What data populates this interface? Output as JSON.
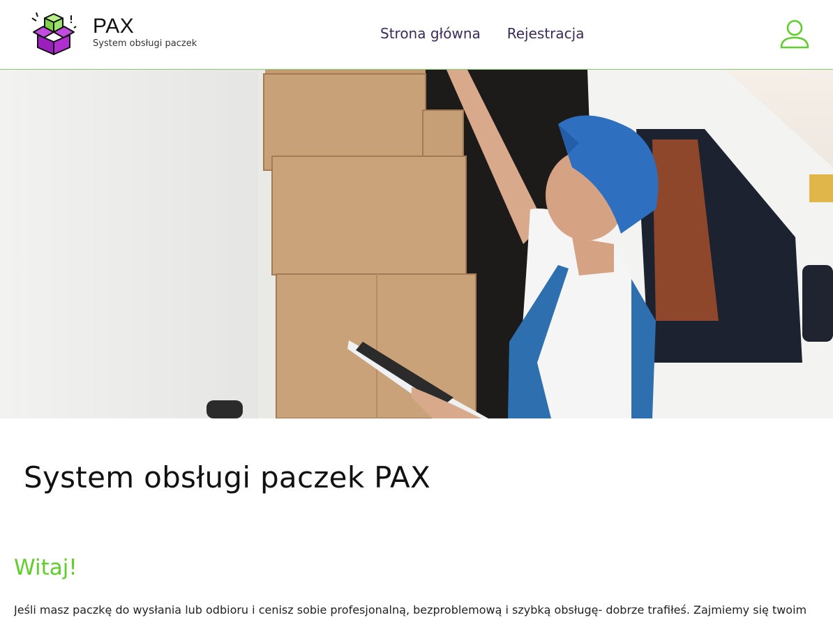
{
  "header": {
    "brand_name": "PAX",
    "brand_tagline": "System obsługi paczek",
    "logo_icon": "package-box-icon",
    "user_icon": "user-account-icon",
    "colors": {
      "accent": "#5fcf2b",
      "nav_text": "#3c2a59",
      "logo_purple": "#a020c8",
      "logo_green": "#8fe36a"
    }
  },
  "nav": {
    "items": [
      {
        "label": "Strona główna"
      },
      {
        "label": "Rejestracja"
      }
    ]
  },
  "hero": {
    "image": "courier-loading-van-photo"
  },
  "main": {
    "title": "System obsługi paczek PAX",
    "welcome": "Witaj!",
    "intro": "Jeśli masz paczkę do wysłania lub odbioru i cenisz sobie profesjonalną, bezproblemową i szybką obsługę- dobrze trafiłeś. Zajmiemy się twoim"
  }
}
